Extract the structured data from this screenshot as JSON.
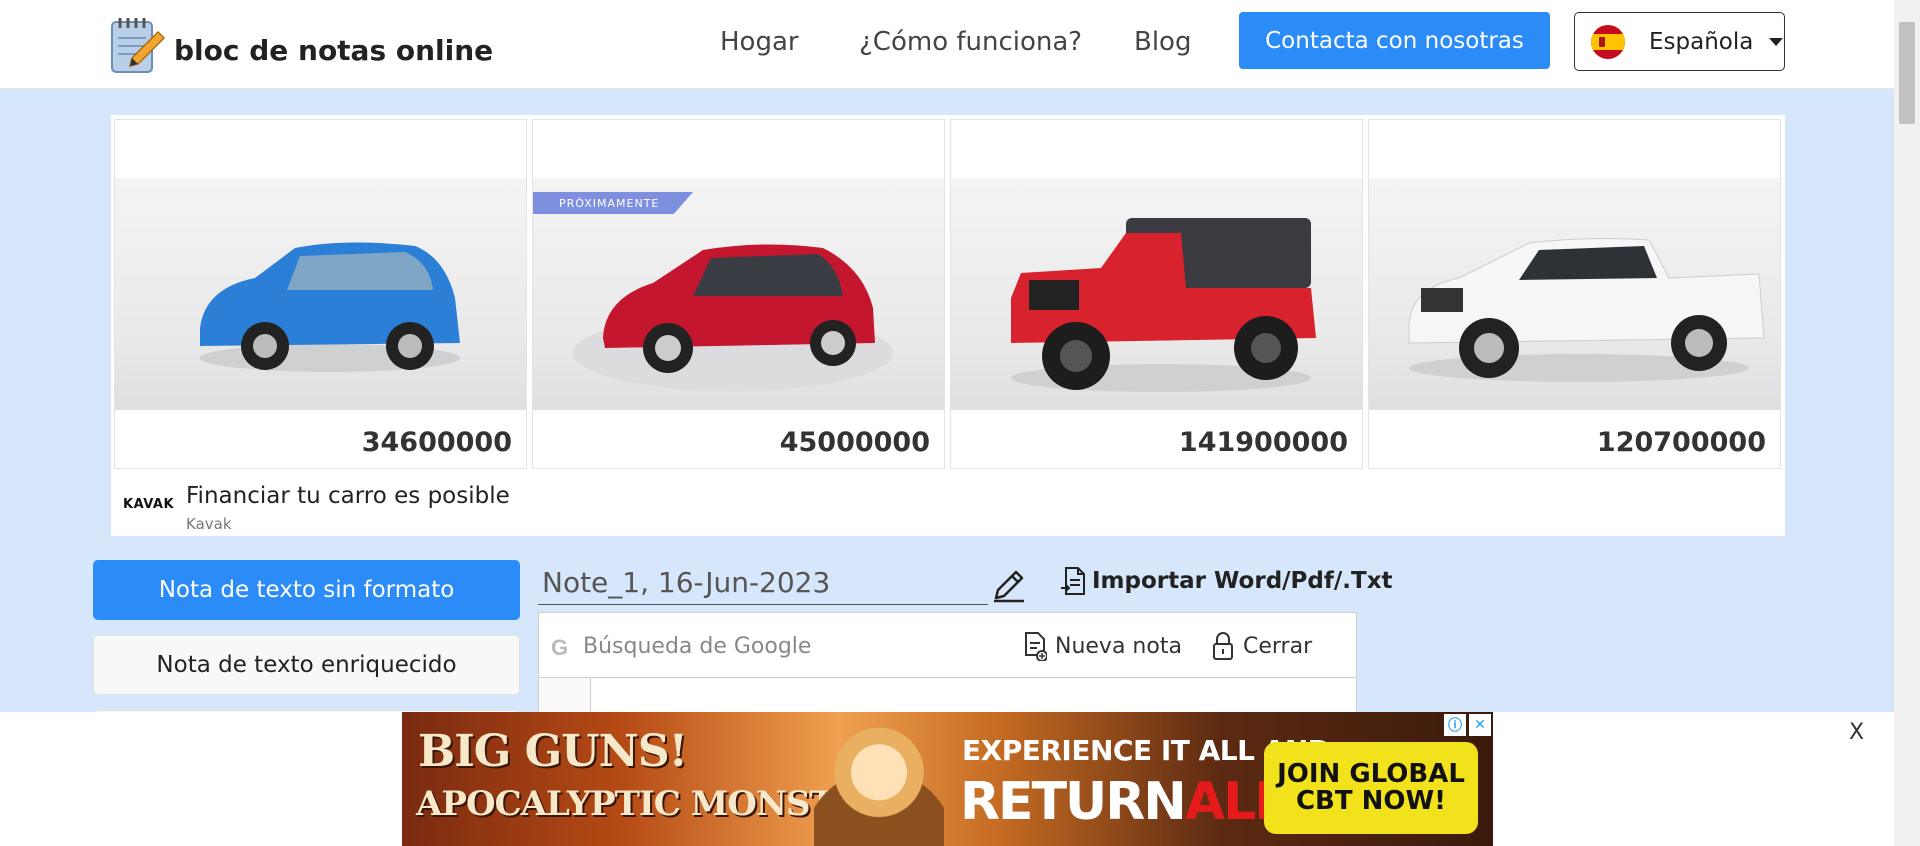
{
  "header": {
    "logo_text": "bloc de notas online",
    "nav": [
      "Hogar",
      "¿Cómo funciona?",
      "Blog"
    ],
    "contact_label": "Contacta con nosotras",
    "language": "Española",
    "brand_color": "#2b8bf7"
  },
  "ad_top": {
    "cars": [
      {
        "price": "34600000",
        "badge": ""
      },
      {
        "price": "45000000",
        "badge": "PRÓXIMAMENTE"
      },
      {
        "price": "141900000",
        "badge": ""
      },
      {
        "price": "120700000",
        "badge": ""
      }
    ],
    "brand_logo": "KAVAK",
    "headline": "Financiar tu carro es posible",
    "advertiser": "Kavak"
  },
  "sidebar": {
    "plain_label": "Nota de texto sin formato",
    "rich_label": "Nota de texto enriquecido"
  },
  "note": {
    "title": "Note_1, 16-Jun-2023",
    "import_label": "Importar Word/Pdf/.Txt",
    "search_placeholder": "Búsqueda de Google",
    "search_prefix": "G",
    "new_note_label": "Nueva nota",
    "close_label": "Cerrar"
  },
  "ad_bottom": {
    "close_label": "X",
    "line1": "BIG GUNS!",
    "line2": "APOCALYPTIC MONSTERS!",
    "line3": "EXPERIENCE IT ALL AND",
    "line4a": "RETURN",
    "line4b": "ALIVE",
    "cta": "JOIN GLOBAL\nCBT NOW!"
  }
}
